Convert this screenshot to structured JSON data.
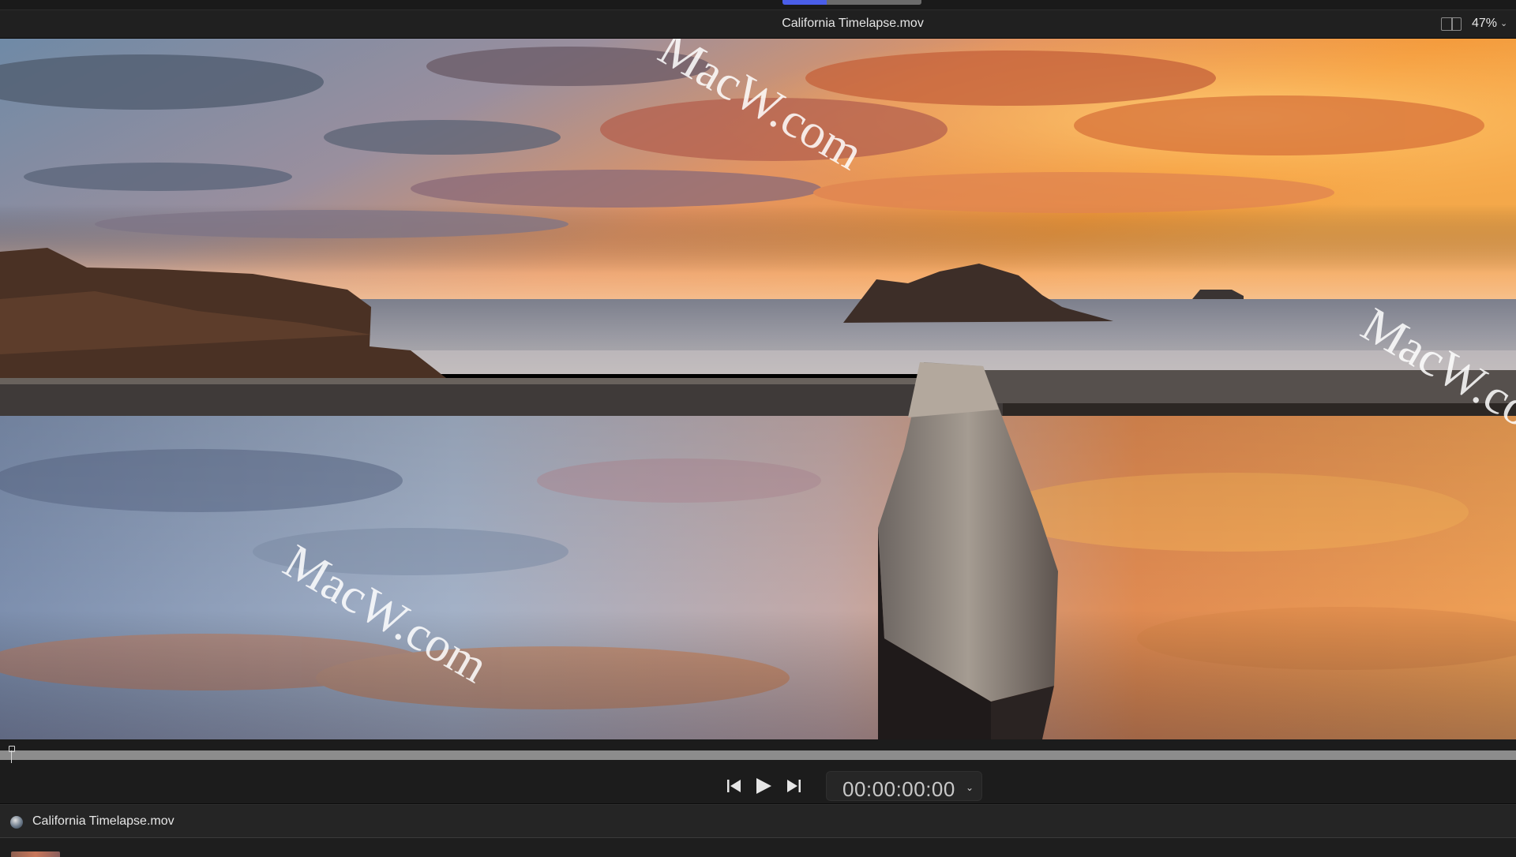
{
  "header": {
    "viewer_title": "California Timelapse.mov",
    "zoom_level": "47%"
  },
  "viewer": {
    "watermark_text": "MacW.com"
  },
  "transport": {
    "timecode": "00:00:00:00"
  },
  "timeline": {
    "clip_title": "California Timelapse.mov"
  },
  "playhead_position": 0,
  "colors": {
    "accent": "#4a5ee8",
    "panel_bg": "#1c1c1c",
    "scrub_track": "#8c8c8c"
  },
  "icons": [
    "layout-toggle-icon",
    "chevron-down-icon",
    "skip-back-icon",
    "play-icon",
    "skip-forward-icon",
    "clip-icon"
  ]
}
